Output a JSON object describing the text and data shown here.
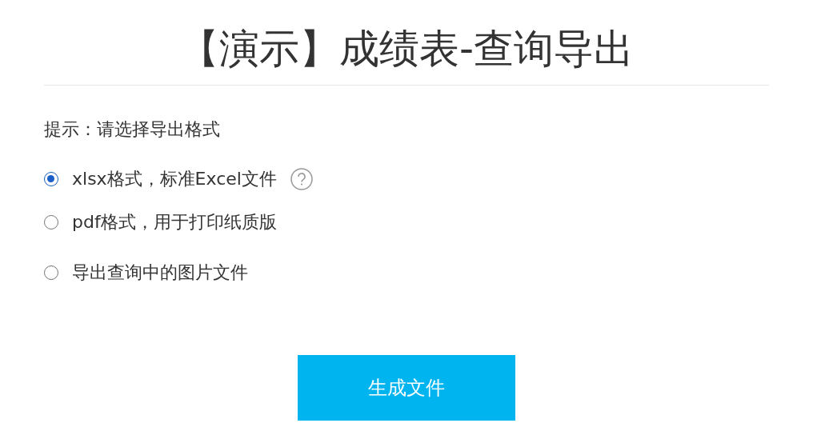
{
  "title": "【演示】成绩表-查询导出",
  "hint": "提示：请选择导出格式",
  "options": [
    {
      "label": "xlsx格式，标准Excel文件",
      "selected": true,
      "help": true
    },
    {
      "label": "pdf格式，用于打印纸质版",
      "selected": false,
      "help": false
    },
    {
      "label": "导出查询中的图片文件",
      "selected": false,
      "help": false
    }
  ],
  "button": "生成文件"
}
